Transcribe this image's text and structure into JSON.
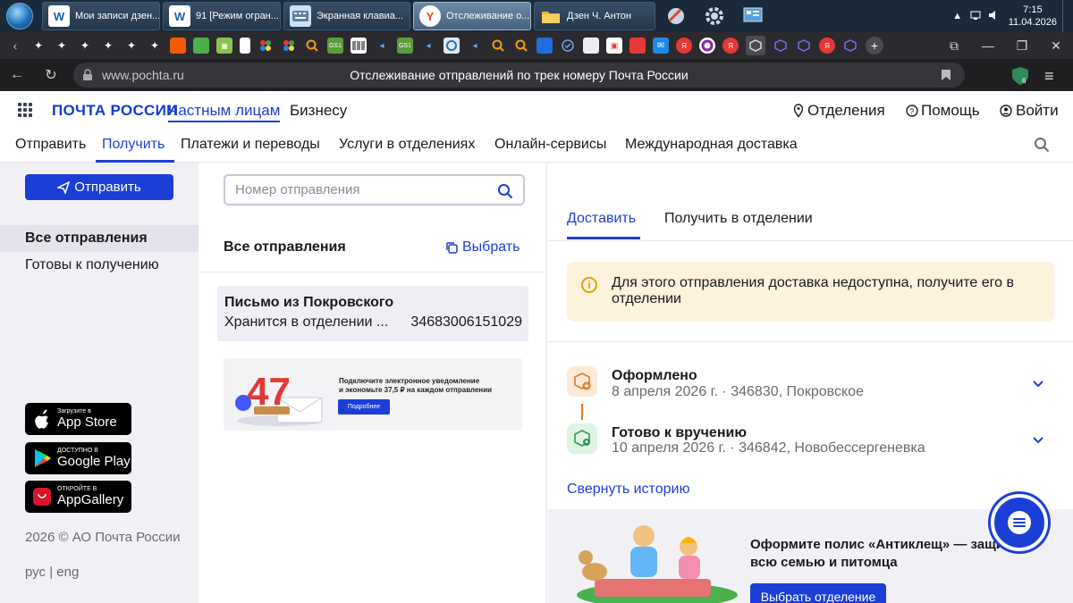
{
  "taskbar": {
    "tasks": [
      {
        "label": "Мои записи дзен...",
        "icon": "W",
        "color": "#1a5fb4"
      },
      {
        "label": "91 [Режим огран...",
        "icon": "W",
        "color": "#1a5fb4"
      },
      {
        "label": "Экранная клавиа...",
        "icon": "kbd",
        "color": "#2c6aa0"
      },
      {
        "label": "Отслеживание о...",
        "icon": "Y",
        "color": "#fc3f1d"
      },
      {
        "label": "Дзен Ч. Антон",
        "icon": "folder",
        "color": "#e8b43a"
      }
    ],
    "clock_time": "7:15",
    "clock_date": "11.04.2026"
  },
  "browser": {
    "url_domain": "www.pochta.ru",
    "page_title": "Отслеживание отправлений по трек номеру Почта России"
  },
  "header": {
    "logo": "ПОЧТА РОССИИ",
    "private": "Частным лицам",
    "business": "Бизнесу",
    "offices": "Отделения",
    "help": "Помощь",
    "login": "Войти"
  },
  "nav": {
    "items": [
      "Отправить",
      "Получить",
      "Платежи и переводы",
      "Услуги в отделениях",
      "Онлайн-сервисы",
      "Международная доставка"
    ]
  },
  "sidebar": {
    "send_button": "Отправить",
    "items": [
      "Все отправления",
      "Готовы к получению"
    ],
    "stores": [
      {
        "sub": "Загрузите в",
        "main": "App Store"
      },
      {
        "sub": "ДОСТУПНО В",
        "main": "Google Play"
      },
      {
        "sub": "ОТКРОЙТЕ В",
        "main": "AppGallery"
      }
    ],
    "copyright": "2026 © АО Почта России",
    "lang_ru": "рус",
    "lang_sep": "|",
    "lang_en": "eng"
  },
  "middle": {
    "search_placeholder": "Номер отправления",
    "title": "Все отправления",
    "select_label": "Выбрать",
    "shipment": {
      "title": "Письмо из Покровского",
      "status": "Хранится в отделении ...",
      "track": "34683006151029"
    },
    "promo": {
      "number": "47",
      "line1": "Подключите электронное уведомление",
      "line2": "и экономьте 37,5 ₽ на каждом отправлении",
      "button": "Подробнее"
    }
  },
  "right": {
    "tab_delivery": "Доставить",
    "tab_pickup": "Получить в отделении",
    "notice": "Для этого отправления доставка недоступна, получите его в отделении",
    "steps": [
      {
        "title": "Оформлено",
        "sub": "8 апреля 2026 г. · 346830, Покровское",
        "color": "#fde9d7"
      },
      {
        "title": "Готово к вручению",
        "sub": "10 апреля 2026 г. · 346842, Новобессергеневка",
        "color": "#dff3e3"
      }
    ],
    "collapse": "Свернуть историю",
    "ad_text": "Оформите полис «Антиклещ» — защитите всю семью и питомца",
    "ad_button": "Выбрать отделение"
  },
  "colors": {
    "brand": "#1b3fd6",
    "notice_bg": "#fdf2dc",
    "sidebar_bg": "#f1f1f5"
  }
}
